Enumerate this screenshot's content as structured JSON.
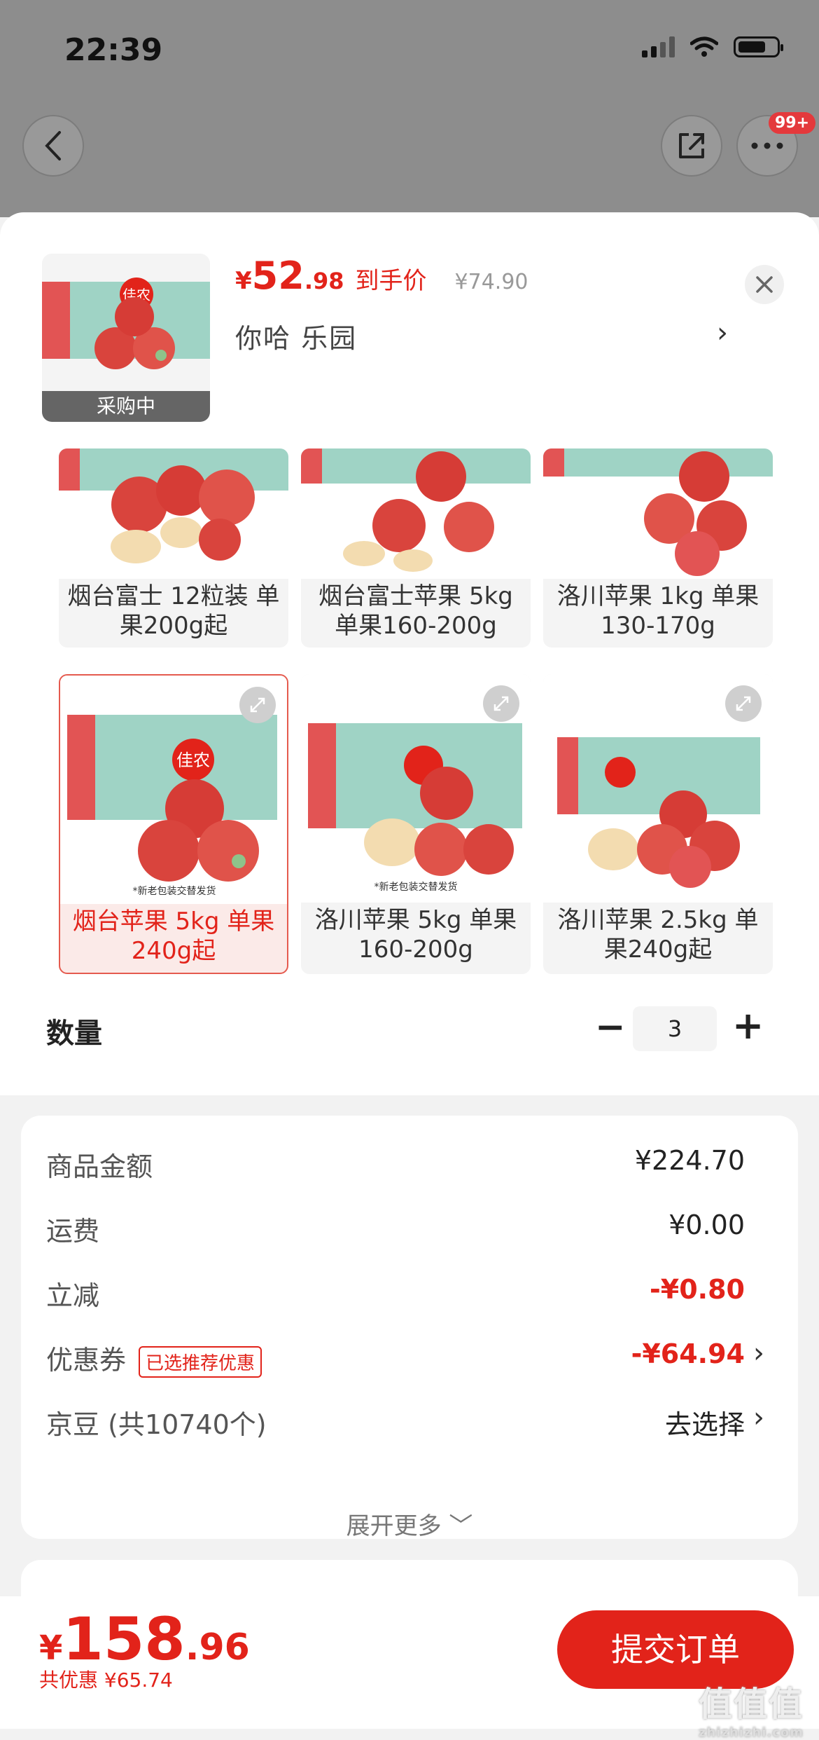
{
  "status_bar": {
    "time": "22:39"
  },
  "top_nav": {
    "badge": "99+"
  },
  "product": {
    "thumb_label": "采购中",
    "price_currency": "¥",
    "price_int": "52",
    "price_dec": ".98",
    "price_tag": "到手价",
    "original_price": "¥74.90",
    "shop_name": "你哈  乐园"
  },
  "variants": [
    {
      "label": "烟台富士 12粒装 单果200g起",
      "selected": false
    },
    {
      "label": "烟台富士苹果 5kg 单果160-200g",
      "selected": false
    },
    {
      "label": "洛川苹果 1kg 单果130-170g",
      "selected": false
    },
    {
      "label": "烟台苹果 5kg 单果240g起",
      "selected": true
    },
    {
      "label": "洛川苹果 5kg 单果160-200g",
      "selected": false
    },
    {
      "label": "洛川苹果 2.5kg 单果240g起",
      "selected": false
    }
  ],
  "box_text": {
    "brand": "佳农",
    "note": "*新老包装交替发货"
  },
  "quantity": {
    "label": "数量",
    "value": "3",
    "minus": "−",
    "plus": "+"
  },
  "summary": {
    "goods_label": "商品金额",
    "goods_value": "¥224.70",
    "shipping_label": "运费",
    "shipping_value": "¥0.00",
    "discount_label": "立减",
    "discount_value": "-¥0.80",
    "coupon_label": "优惠券",
    "coupon_tag": "已选推荐优惠",
    "coupon_value": "-¥64.94",
    "beans_label": "京豆 (共10740个)",
    "beans_value": "去选择",
    "expand_more": "展开更多 ﹀"
  },
  "bottom": {
    "total_currency": "¥",
    "total_int": "158",
    "total_dec": ".96",
    "saving": "共优惠 ¥65.74",
    "submit_label": "提交订单"
  },
  "watermark": {
    "text": "值值值",
    "sub": "zhizhizhi.com"
  },
  "colors": {
    "accent": "#e2231a",
    "selected_border": "#e55a4e"
  }
}
